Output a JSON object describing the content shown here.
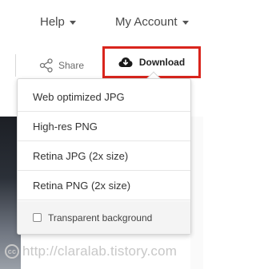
{
  "header": {
    "help_label": "Help",
    "account_label": "My Account"
  },
  "toolbar": {
    "share_label": "Share",
    "download_label": "Download"
  },
  "download_menu": {
    "items": [
      {
        "label": "Web optimized JPG"
      },
      {
        "label": "High-res PNG"
      },
      {
        "label": "Retina JPG (2x size)"
      },
      {
        "label": "Retina PNG (2x size)"
      }
    ],
    "transparent_label": "Transparent background",
    "transparent_checked": false
  },
  "watermark": {
    "text": "http://claralab.tistory.com",
    "icon_text": "cc"
  },
  "colors": {
    "highlight": "#d9251d",
    "text": "#333333",
    "footer_bg": "#f4f4f4"
  }
}
